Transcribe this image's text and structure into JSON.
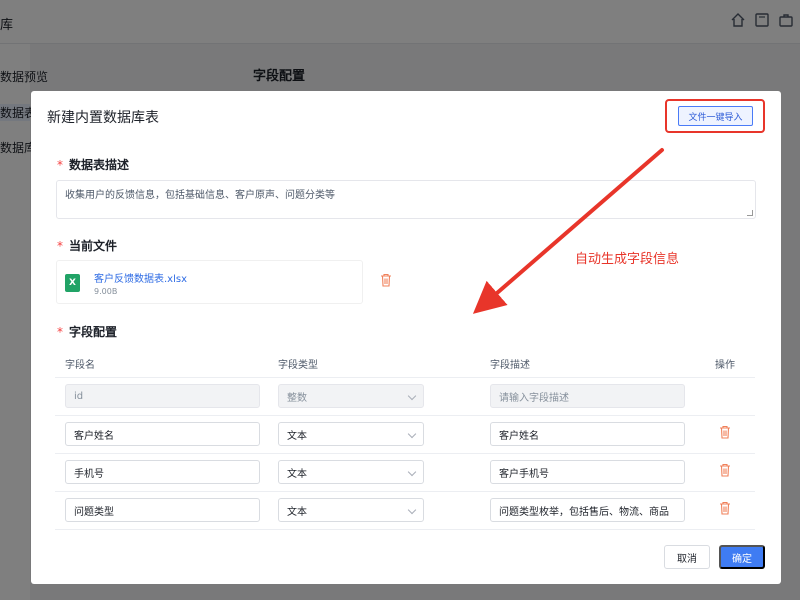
{
  "background": {
    "title_fragment": "库",
    "sidebar_items": [
      "数据预览",
      "数据表",
      "数据库"
    ],
    "content_title": "字段配置",
    "header_icons": [
      "home-icon",
      "book-icon",
      "briefcase-icon"
    ]
  },
  "modal": {
    "title": "新建内置数据库表",
    "import_button": "文件一键导入",
    "description": {
      "label": "数据表描述",
      "value": "收集用户的反馈信息，包括基础信息、客户原声、问题分类等"
    },
    "current_file": {
      "label": "当前文件",
      "name": "客户反馈数据表.xlsx",
      "size": "9.00B"
    },
    "annotation": "自动生成字段信息",
    "fields": {
      "label": "字段配置",
      "columns": [
        "字段名",
        "字段类型",
        "字段描述",
        "操作"
      ],
      "rows": [
        {
          "name": "id",
          "type": "整数",
          "desc": "",
          "desc_placeholder": "请输入字段描述",
          "disabled": true
        },
        {
          "name": "客户姓名",
          "type": "文本",
          "desc": "客户姓名",
          "disabled": false
        },
        {
          "name": "手机号",
          "type": "文本",
          "desc": "客户手机号",
          "disabled": false
        },
        {
          "name": "问题类型",
          "type": "文本",
          "desc": "问题类型枚举，包括售后、物流、商品",
          "disabled": false
        }
      ]
    },
    "cancel_button": "取消",
    "ok_button": "确定"
  },
  "colors": {
    "accent": "#3f7cf3",
    "annotation_red": "#e8352a",
    "required_red": "#f53f3f",
    "trash_orange": "#f0805a",
    "excel_green": "#21a366"
  }
}
